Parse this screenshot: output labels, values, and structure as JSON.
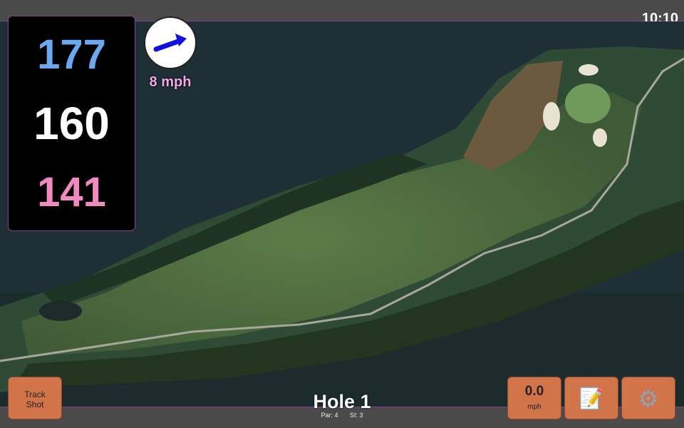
{
  "status_bar": {
    "time": "10:10"
  },
  "yardages": {
    "back": "177",
    "middle": "160",
    "front": "141"
  },
  "wind": {
    "speed": "8 mph"
  },
  "hole": {
    "title": "Hole 1",
    "par": "Par: 4",
    "stroke_index": "SI: 3"
  },
  "buttons": {
    "track_shot": [
      "Track",
      "Shot"
    ],
    "speed": {
      "value": "0.0",
      "unit": "mph"
    },
    "notes_icon": "notepad-icon",
    "settings_icon": "gear-icon"
  },
  "colors": {
    "back_yardage": "#6aa8f0",
    "middle_yardage": "#ffffff",
    "front_yardage": "#f08ac0",
    "button": "#d2744a",
    "wind_arrow": "#1010e0",
    "wind_text": "#f0a8e8"
  }
}
